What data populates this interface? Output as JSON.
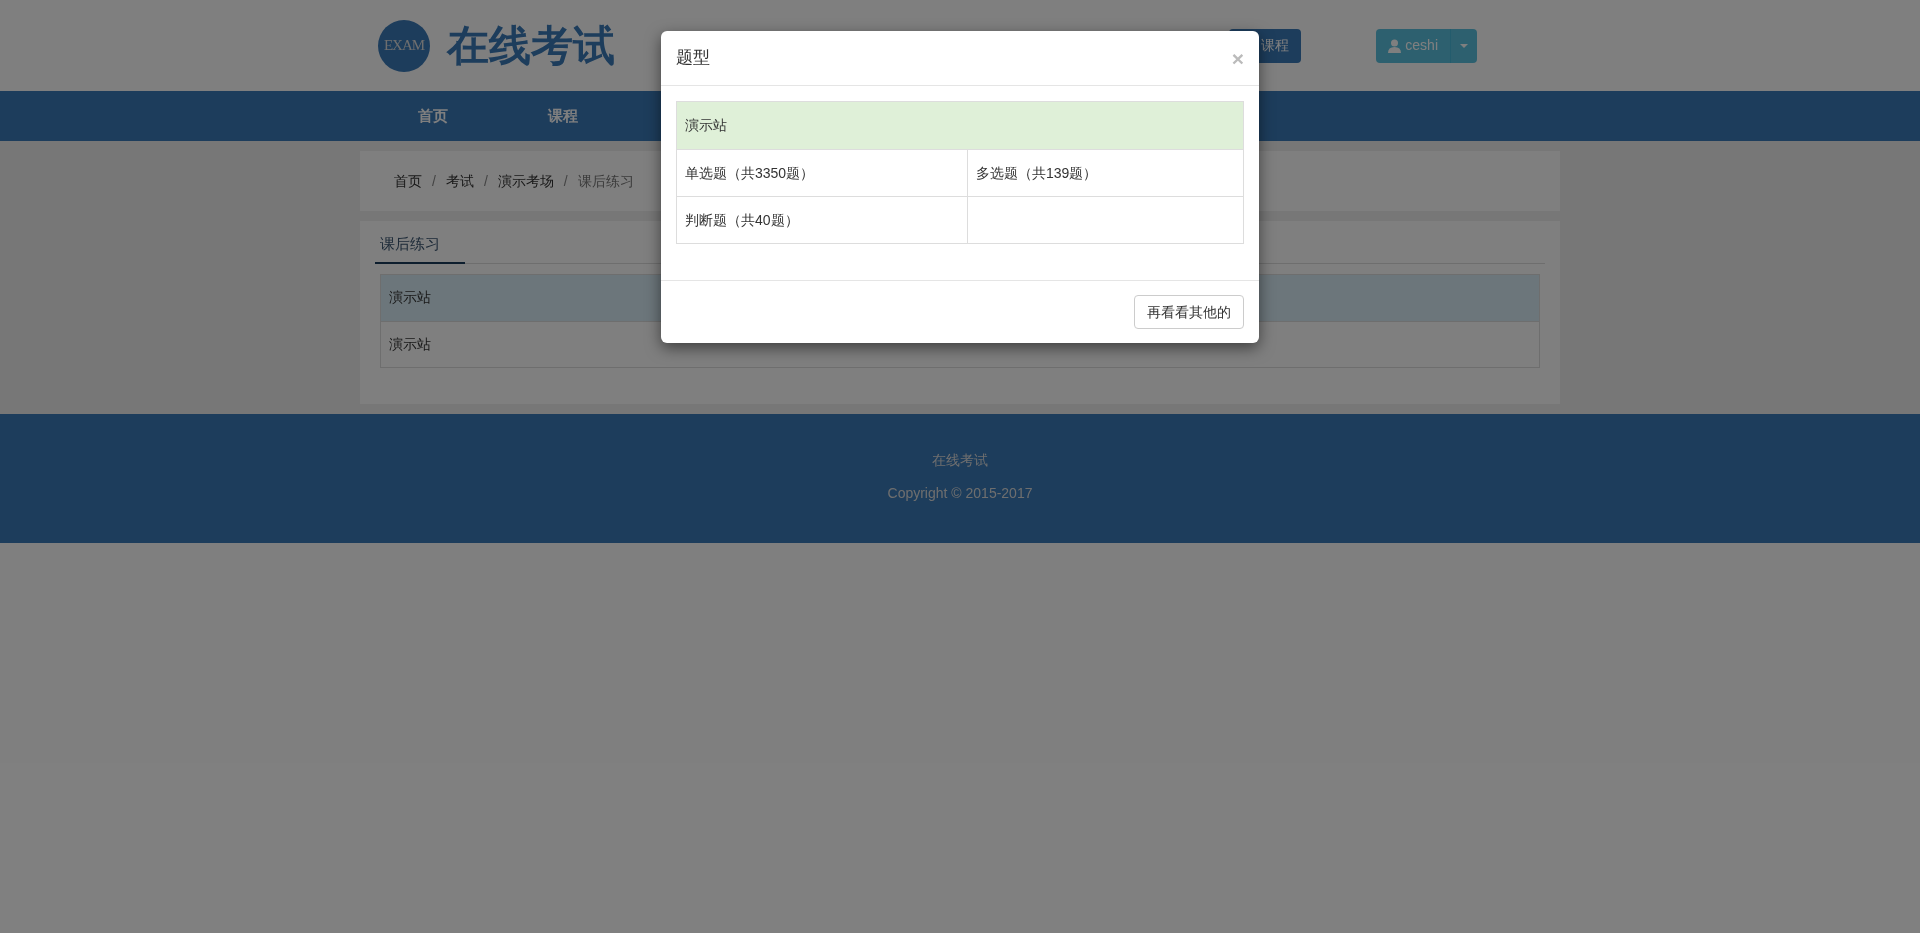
{
  "header": {
    "logo_text": "EXAM",
    "site_title": "在线考试",
    "course_button": "课程",
    "user_button": "ceshi"
  },
  "nav": {
    "items": [
      "首页",
      "课程"
    ]
  },
  "breadcrumb": {
    "separator": "/",
    "items": [
      {
        "label": "首页",
        "current": false
      },
      {
        "label": "考试",
        "current": false
      },
      {
        "label": "演示考场",
        "current": false
      },
      {
        "label": "课后练习",
        "current": true
      }
    ]
  },
  "tabs": [
    {
      "label": "课后练习",
      "selected": true
    }
  ],
  "table": {
    "rows": [
      {
        "kind": "header",
        "label": "演示站"
      },
      {
        "kind": "row",
        "label": "演示站"
      }
    ]
  },
  "footer": {
    "title": "在线考试",
    "copyright": "Copyright © 2015-2017"
  },
  "modal": {
    "title": "题型",
    "close": "×",
    "group": "演示站",
    "rows": [
      {
        "cells": [
          "单选题（共3350题）",
          "多选题（共139题）"
        ]
      },
      {
        "cells": [
          "判断题（共40题）"
        ]
      }
    ],
    "button": "再看看其他的"
  }
}
